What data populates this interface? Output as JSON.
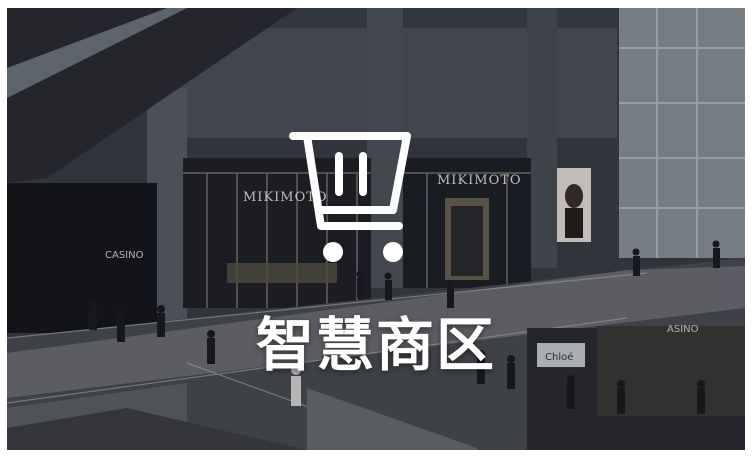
{
  "card": {
    "title": "智慧商区",
    "icon": "shopping-cart-icon",
    "background_image": "shopping-mall-photo"
  },
  "mall_signs": {
    "store_left": "MIKIMOTO",
    "store_right": "MIKIMOTO",
    "casino_left": "CASINO",
    "casino_right": "ASINO",
    "chloe": "Chloé"
  },
  "colors": {
    "overlay_text": "#ffffff",
    "mall_dark": "#2c2f33"
  }
}
